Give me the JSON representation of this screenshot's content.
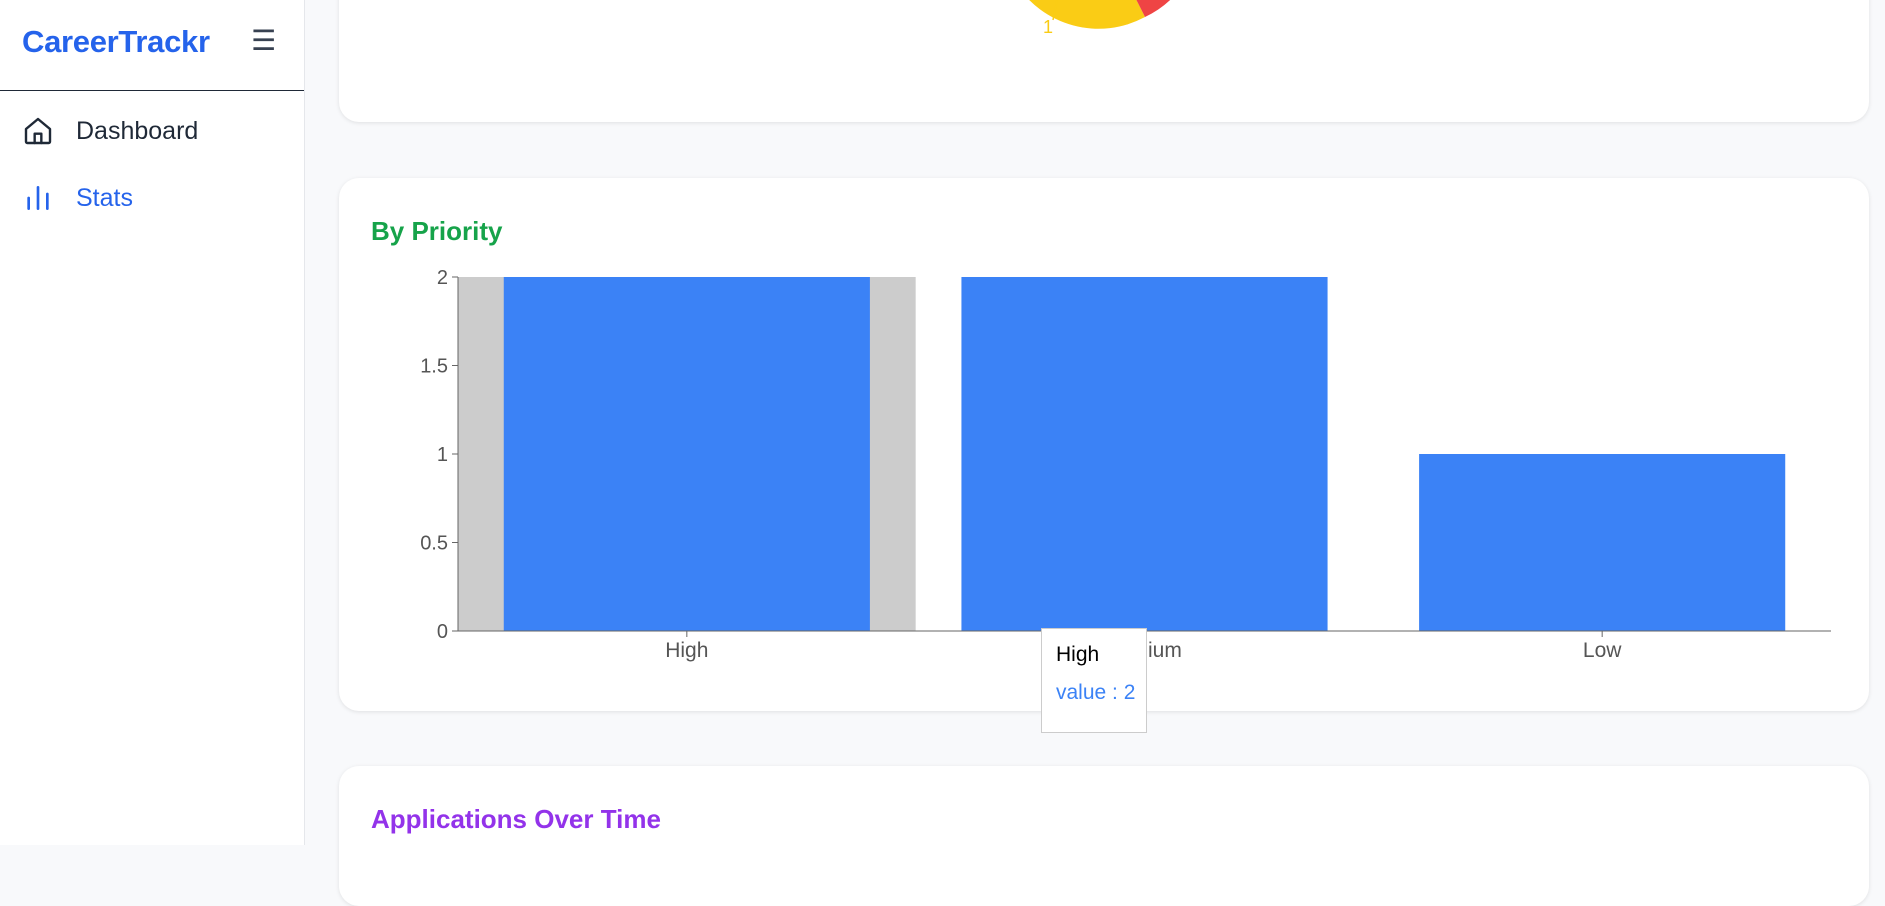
{
  "app": {
    "brand": "CareerTrackr",
    "menu_icon": "☰"
  },
  "sidebar": {
    "items": [
      {
        "label": "Dashboard",
        "icon": "home-icon",
        "active": false
      },
      {
        "label": "Stats",
        "icon": "bar-chart-icon",
        "active": true
      }
    ]
  },
  "top_card": {
    "pie_label": "1",
    "colors": {
      "slice_a": "#facc15",
      "slice_b": "#ef4444"
    }
  },
  "priority_card": {
    "title": "By Priority",
    "tooltip": {
      "label": "High",
      "value_text": "value : 2"
    }
  },
  "time_card": {
    "title": "Applications Over Time"
  },
  "chart_data": {
    "type": "bar",
    "categories": [
      "High",
      "Medium",
      "Low"
    ],
    "values": [
      2,
      2,
      1
    ],
    "ylim": [
      0,
      2
    ],
    "yticks": [
      0,
      0.5,
      1,
      1.5,
      2
    ],
    "ytick_labels": [
      "0",
      "0.5",
      "1",
      "1.5",
      "2"
    ],
    "bar_color": "#3b82f6",
    "hover_category": "High",
    "hover_color": "#cccccc"
  }
}
